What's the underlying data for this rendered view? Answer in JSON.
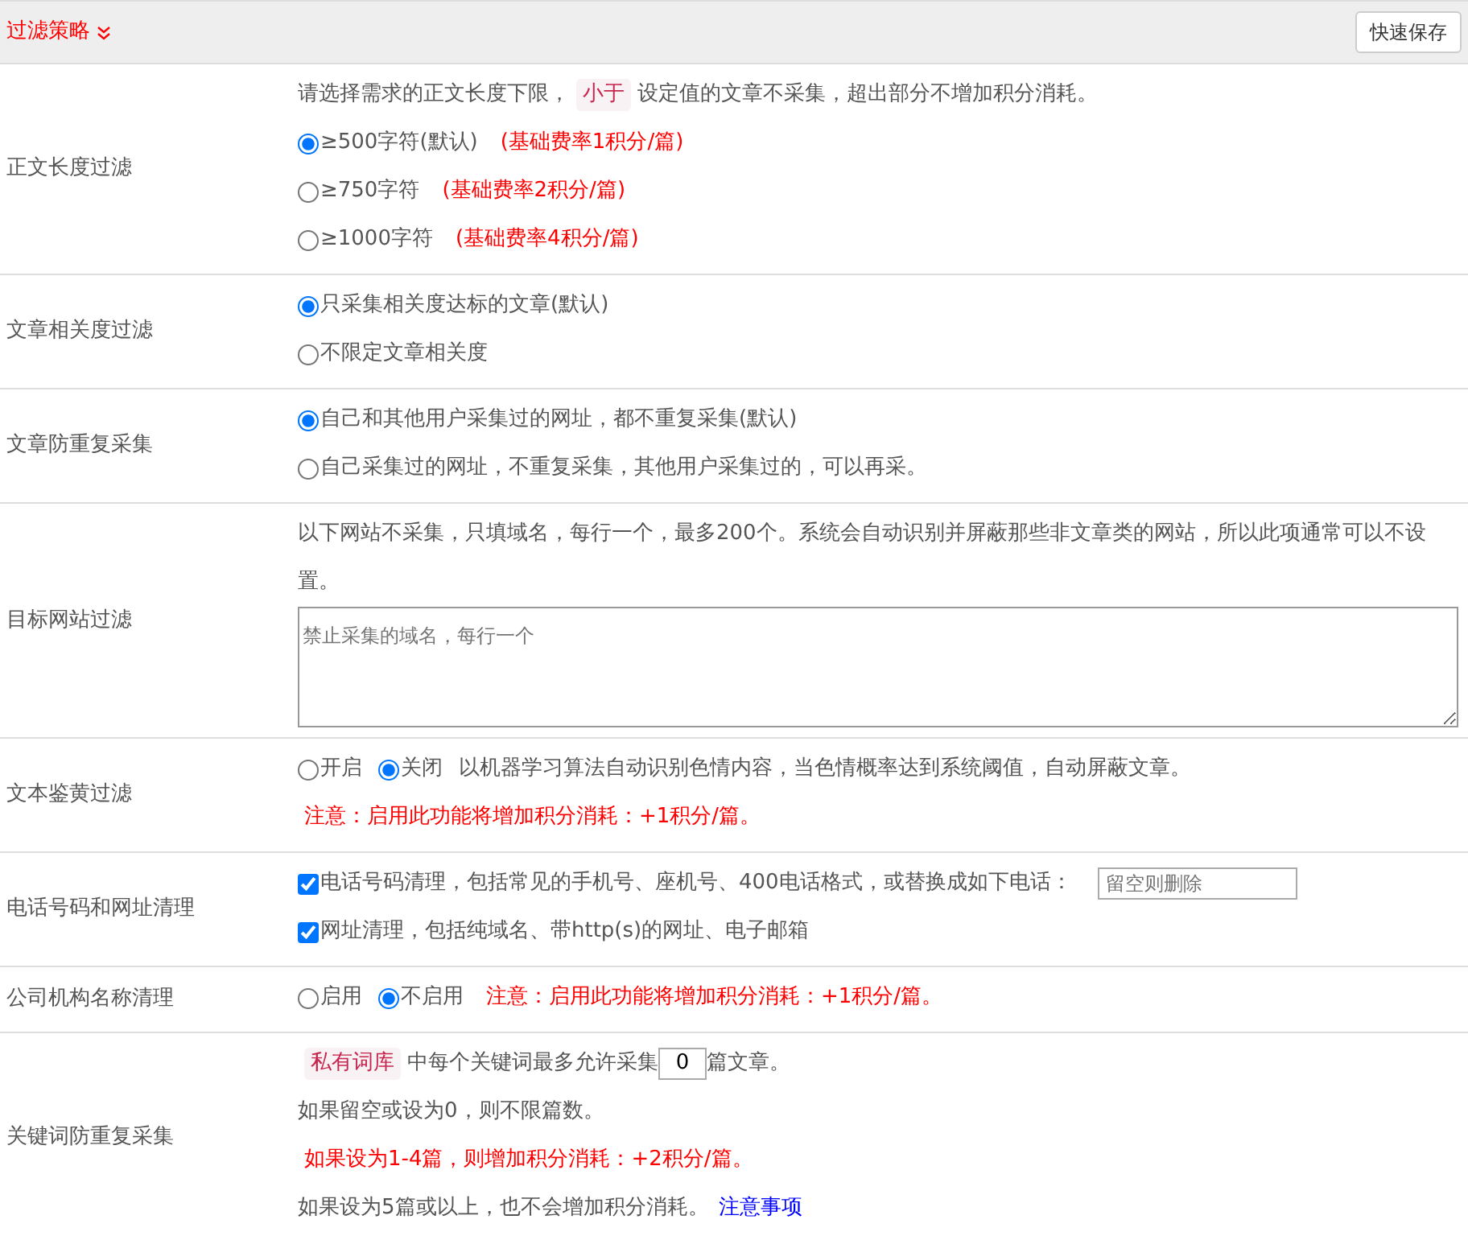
{
  "header": {
    "title": "过滤策略",
    "button": "快速保存"
  },
  "rows": [
    {
      "label": "正文长度过滤",
      "lines": [
        [
          {
            "kind": "text",
            "text": "请选择需求的正文长度下限，"
          },
          {
            "kind": "tag",
            "text": "小于"
          },
          {
            "kind": "text",
            "text": "设定值的文章不采集，超出部分不增加积分消耗。"
          }
        ],
        [
          {
            "kind": "radio",
            "text": "≥500字符(默认)",
            "selected": true
          },
          {
            "kind": "note",
            "text": "(基础费率1积分/篇)"
          }
        ],
        [
          {
            "kind": "radio",
            "text": "≥750字符",
            "selected": false
          },
          {
            "kind": "note",
            "text": "(基础费率2积分/篇)"
          }
        ],
        [
          {
            "kind": "radio",
            "text": "≥1000字符",
            "selected": false
          },
          {
            "kind": "note",
            "text": "(基础费率4积分/篇)"
          }
        ]
      ]
    },
    {
      "label": "文章相关度过滤",
      "lines": [
        [
          {
            "kind": "radio",
            "text": "只采集相关度达标的文章(默认)",
            "selected": true
          }
        ],
        [
          {
            "kind": "radio",
            "text": "不限定文章相关度",
            "selected": false
          }
        ]
      ]
    },
    {
      "label": "文章防重复采集",
      "lines": [
        [
          {
            "kind": "radio",
            "text": "自己和其他用户采集过的网址，都不重复采集(默认)",
            "selected": true
          }
        ],
        [
          {
            "kind": "radio",
            "text": "自己采集过的网址，不重复采集，其他用户采集过的，可以再采。",
            "selected": false
          }
        ]
      ]
    },
    {
      "label": "目标网站过滤",
      "lines": [
        [
          {
            "kind": "text",
            "text": "以下网站不采集，只填域名，每行一个，最多200个。系统会自动识别并屏蔽那些非文章类的网站，所以此项通常可以不设置。"
          }
        ],
        [
          {
            "kind": "textarea",
            "placeholder": "禁止采集的域名，每行一个"
          }
        ]
      ]
    },
    {
      "label": "文本鉴黄过滤",
      "lines": [
        [
          {
            "kind": "radio",
            "text": "开启",
            "selected": false
          },
          {
            "kind": "radio",
            "text": "关闭",
            "selected": true
          },
          {
            "kind": "text",
            "text": "以机器学习算法自动识别色情内容，当色情概率达到系统阈值，自动屏蔽文章。"
          }
        ],
        [
          {
            "kind": "note",
            "text": "注意：启用此功能将增加积分消耗：+1积分/篇。"
          }
        ]
      ]
    },
    {
      "label": "电话号码和网址清理",
      "lines": [
        [
          {
            "kind": "checkbox",
            "text": "电话号码清理，包括常见的手机号、座机号、400电话格式，或替换成如下电话：",
            "checked": true
          },
          {
            "kind": "input",
            "placeholder": "留空则删除"
          }
        ],
        [
          {
            "kind": "checkbox",
            "text": "网址清理，包括纯域名、带http(s)的网址、电子邮箱",
            "checked": true
          }
        ]
      ]
    },
    {
      "label": "公司机构名称清理",
      "lines": [
        [
          {
            "kind": "radio",
            "text": "启用",
            "selected": false
          },
          {
            "kind": "radio",
            "text": "不启用",
            "selected": true
          },
          {
            "kind": "note",
            "text": "注意：启用此功能将增加积分消耗：+1积分/篇。"
          }
        ]
      ]
    },
    {
      "label": "关键词防重复采集",
      "lines": [
        [
          {
            "kind": "tag",
            "text": "私有词库"
          },
          {
            "kind": "text",
            "text": "中每个关键词最多允许采集"
          },
          {
            "kind": "number",
            "value": "0"
          },
          {
            "kind": "text",
            "text": "篇文章。"
          }
        ],
        [
          {
            "kind": "text",
            "text": "如果留空或设为0，则不限篇数。"
          }
        ],
        [
          {
            "kind": "note",
            "text": "如果设为1-4篇，则增加积分消耗：+2积分/篇。"
          }
        ],
        [
          {
            "kind": "text",
            "text": "如果设为5篇或以上，也不会增加积分消耗。"
          },
          {
            "kind": "link",
            "text": "注意事项"
          }
        ]
      ]
    }
  ]
}
